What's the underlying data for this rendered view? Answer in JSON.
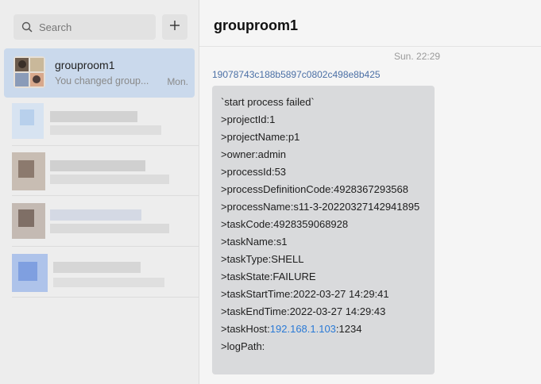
{
  "sidebar": {
    "search": {
      "placeholder": "Search",
      "icon": "search-icon"
    },
    "add_button": {
      "icon": "plus-icon"
    },
    "chats": [
      {
        "title": "grouproom1",
        "preview": "You changed group...",
        "time": "Mon."
      }
    ]
  },
  "main": {
    "title": "grouproom1",
    "timestamp": "Sun. 22:29",
    "sender": "19078743c188b5897c0802c498e8b425",
    "message": {
      "lines": [
        "`start process failed`",
        ">projectId:1",
        ">projectName:p1",
        ">owner:admin",
        ">processId:53",
        ">processDefinitionCode:4928367293568",
        ">processName:s11-3-20220327142941895",
        ">taskCode:4928359068928",
        ">taskName:s1",
        ">taskType:SHELL",
        ">taskState:FAILURE",
        ">taskStartTime:2022-03-27 14:29:41",
        ">taskEndTime:2022-03-27 14:29:43"
      ],
      "host_prefix": ">taskHost:",
      "host_ip": "192.168.1.103",
      "host_port": ":1234",
      "log_path": ">logPath:"
    }
  },
  "colors": {
    "active_chat": "#cad9ec",
    "link": "#2a7ad6",
    "bubble": "#d9dadc"
  }
}
